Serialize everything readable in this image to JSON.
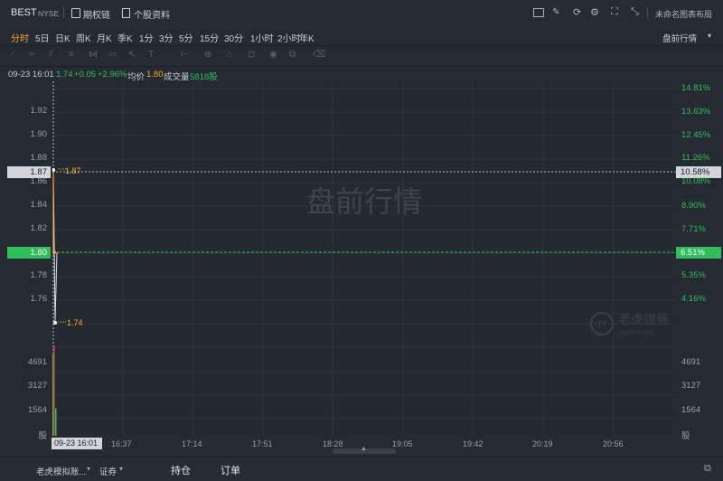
{
  "header": {
    "symbol": "BEST",
    "exchange": "NYSE",
    "options_chain": "期权链",
    "stock_profile": "个股资料",
    "layout": "未命名图表布局"
  },
  "toolbar": {
    "timeframes": [
      "分时",
      "5日",
      "日K",
      "周K",
      "月K",
      "季K",
      "1分",
      "3分",
      "5分",
      "15分",
      "30分",
      "1小时",
      "2小时",
      "年K"
    ],
    "active_index": 0,
    "mode": "盘前行情"
  },
  "info": {
    "datetime": "09-23 16:01",
    "price": "1.74",
    "change": "+0.05",
    "pct": "+2.96%",
    "avg_label": "均价",
    "avg": "1.80",
    "vol_label": "成交量",
    "vol": "5818股"
  },
  "watermark": "盘前行情",
  "brand": {
    "name": "老虎證券",
    "sub": "TIGER TRADE"
  },
  "axis": {
    "left": [
      "1.92",
      "1.90",
      "1.88",
      "1.86",
      "1.84",
      "1.82",
      "1.80",
      "1.78",
      "1.76"
    ],
    "right": [
      "14.81%",
      "13.63%",
      "12.45%",
      "11.26%",
      "10.08%",
      "8.90%",
      "7.71%",
      "5.35%",
      "4.16%"
    ],
    "left_price_tag": "1.87",
    "left_avg_tag": "1.80",
    "right_price_tag": "10.58%",
    "right_avg_tag": "6.51%",
    "vol_left": [
      "4691",
      "3127",
      "1564",
      "股"
    ],
    "vol_right": [
      "4691",
      "3127",
      "1564",
      "股"
    ],
    "x": [
      "16:01",
      "16:37",
      "17:14",
      "17:51",
      "18:28",
      "19:05",
      "19:42",
      "20:19",
      "20:56"
    ],
    "x_cursor": "09-23 16:01"
  },
  "markers": {
    "high": "1.87",
    "low": "1.74"
  },
  "chart_data": {
    "type": "line",
    "x": [
      "16:01",
      "16:02"
    ],
    "price": [
      1.87,
      1.74
    ],
    "avg": [
      1.8,
      1.8
    ],
    "volume": [
      4691,
      1564
    ]
  },
  "footer": {
    "account": "老虎模拟账...",
    "asset": "证券",
    "holdings": "持仓",
    "orders": "订单"
  },
  "colors": {
    "up": "#2fbf5a",
    "down": "#e04848",
    "avg": "#f0a92a",
    "price_line": "#d8dbe2"
  }
}
